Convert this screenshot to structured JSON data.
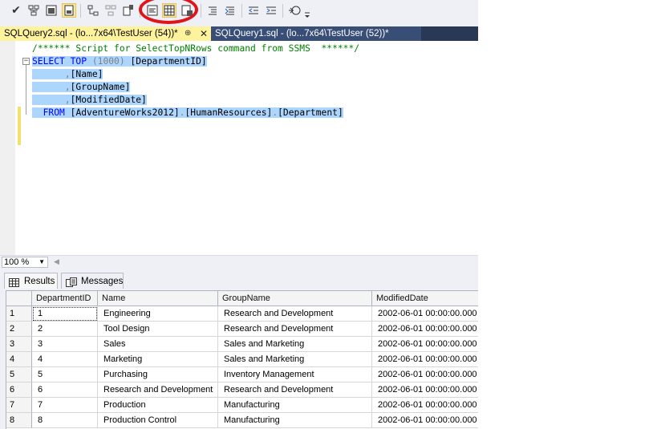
{
  "toolbar": {
    "buttons": [
      {
        "name": "execute-check-icon",
        "glyph": "✔"
      },
      {
        "name": "display-plan-icon"
      },
      {
        "name": "query-designer-icon"
      },
      {
        "name": "query-options-icon"
      },
      {
        "name": "intellisense-icon"
      },
      {
        "name": "include-plan-icon"
      },
      {
        "name": "client-statistics-icon"
      },
      {
        "name": "results-to-text-icon"
      },
      {
        "name": "results-to-grid-icon"
      },
      {
        "name": "results-to-file-icon"
      },
      {
        "name": "comment-icon"
      },
      {
        "name": "uncomment-icon"
      },
      {
        "name": "decrease-indent-icon"
      },
      {
        "name": "increase-indent-icon"
      },
      {
        "name": "specify-values-icon"
      }
    ]
  },
  "tabs": {
    "active": {
      "label": "SQLQuery2.sql - (lo...7x64\\TestUser (54))*",
      "pin": "⊕",
      "close": "✕"
    },
    "inactive": {
      "label": "SQLQuery1.sql - (lo...7x64\\TestUser (52))*"
    }
  },
  "editor": {
    "comment": "/****** Script for SelectTopNRows command from SSMS  ******/",
    "collapse_glyph": "−",
    "kw_select": "SELECT",
    "kw_top": "TOP",
    "top_value": "(1000)",
    "col_department_id": "[DepartmentID]",
    "col_name": "[Name]",
    "col_group_name": "[GroupName]",
    "col_modified_date": "[ModifiedDate]",
    "kw_from": "FROM",
    "db": "[AdventureWorks2012]",
    "schema": "[HumanResources]",
    "table": "[Department]",
    "dot": "."
  },
  "zoom": {
    "value": "100 %"
  },
  "result_tabs": {
    "results": "Results",
    "messages": "Messages"
  },
  "grid": {
    "headers": [
      "",
      "DepartmentID",
      "Name",
      "GroupName",
      "ModifiedDate"
    ],
    "rows": [
      [
        "1",
        "1",
        "Engineering",
        "Research and Development",
        "2002-06-01 00:00:00.000"
      ],
      [
        "2",
        "2",
        "Tool Design",
        "Research and Development",
        "2002-06-01 00:00:00.000"
      ],
      [
        "3",
        "3",
        "Sales",
        "Sales and Marketing",
        "2002-06-01 00:00:00.000"
      ],
      [
        "4",
        "4",
        "Marketing",
        "Sales and Marketing",
        "2002-06-01 00:00:00.000"
      ],
      [
        "5",
        "5",
        "Purchasing",
        "Inventory Management",
        "2002-06-01 00:00:00.000"
      ],
      [
        "6",
        "6",
        "Research and Development",
        "Research and Development",
        "2002-06-01 00:00:00.000"
      ],
      [
        "7",
        "7",
        "Production",
        "Manufacturing",
        "2002-06-01 00:00:00.000"
      ],
      [
        "8",
        "8",
        "Production Control",
        "Manufacturing",
        "2002-06-01 00:00:00.000"
      ]
    ]
  },
  "colors": {
    "highlight_ellipse": "#e0151b",
    "active_tab": "#fff29d",
    "tab_strip": "#293955",
    "selection": "#add6ff"
  }
}
